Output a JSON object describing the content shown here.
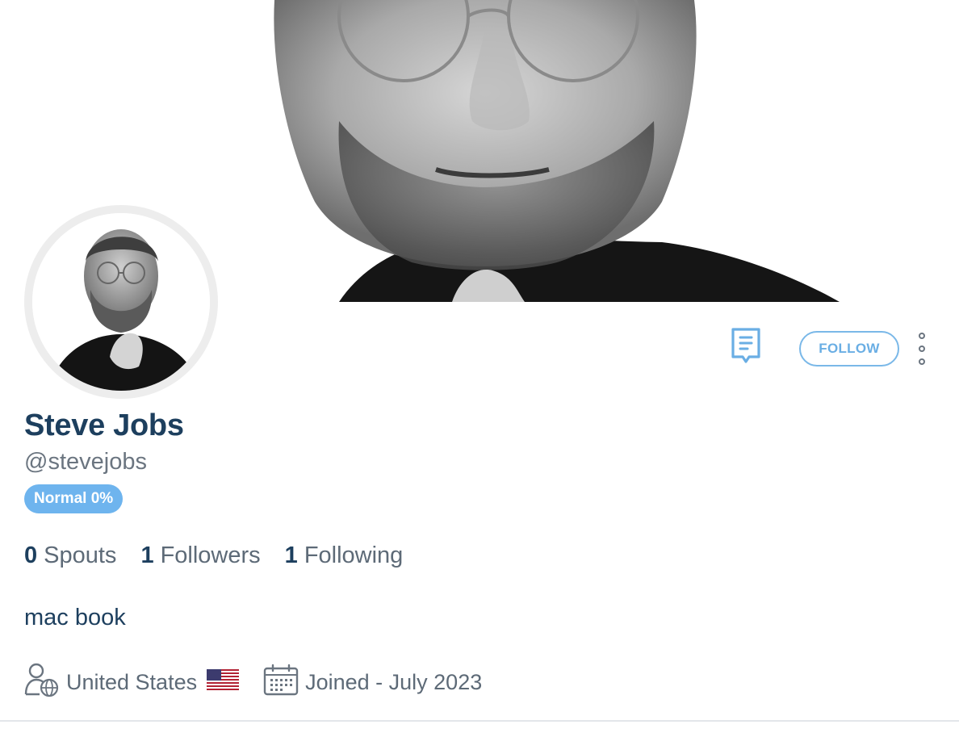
{
  "profile": {
    "name": "Steve Jobs",
    "handle": "@stevejobs",
    "badge": "Normal 0%",
    "bio": "mac book"
  },
  "actions": {
    "follow_label": "FOLLOW"
  },
  "stats": {
    "spouts_count": "0",
    "spouts_label": "Spouts",
    "followers_count": "1",
    "followers_label": "Followers",
    "following_count": "1",
    "following_label": "Following"
  },
  "meta": {
    "location": "United States",
    "joined": "Joined - July 2023"
  },
  "icons": {
    "message": "message-icon",
    "more": "more-vertical-icon",
    "location": "user-globe-icon",
    "flag": "us-flag-icon",
    "calendar": "calendar-icon"
  },
  "colors": {
    "primary_text": "#1d3f5e",
    "secondary_text": "#5d6a77",
    "accent": "#6aaee4",
    "badge_bg": "#6eb4ee"
  }
}
